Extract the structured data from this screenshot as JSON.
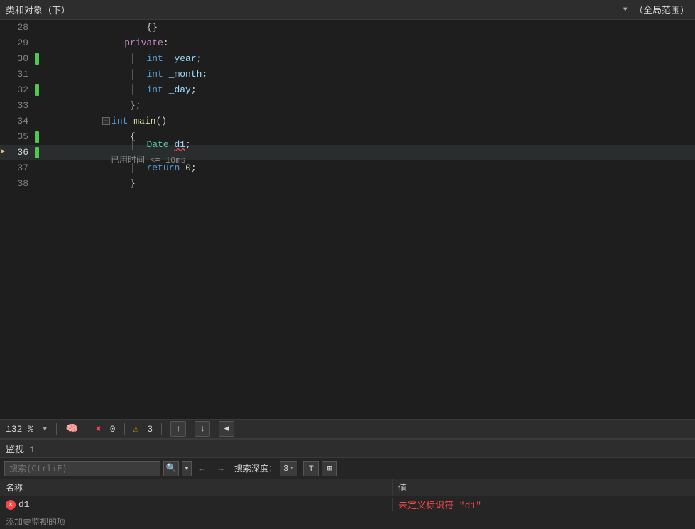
{
  "topbar": {
    "title": "类和对象（下）",
    "dropdown_arrow": "▾",
    "scope": "（全局范围）"
  },
  "editor": {
    "lines": [
      {
        "num": 28,
        "indent": 3,
        "content": "{ }",
        "tokens": [
          {
            "text": "        {}",
            "class": "punct"
          }
        ],
        "indicator": null,
        "current": false
      },
      {
        "num": 29,
        "indent": 2,
        "content": "private:",
        "tokens": [
          {
            "text": "    ",
            "class": ""
          },
          {
            "text": "private",
            "class": "kw2"
          },
          {
            "text": ":",
            "class": "punct"
          }
        ],
        "indicator": null,
        "current": false
      },
      {
        "num": 30,
        "indent": 3,
        "content": "int _year;",
        "tokens": [
          {
            "text": "        ",
            "class": ""
          },
          {
            "text": "int",
            "class": "kw"
          },
          {
            "text": " _year",
            "class": "var"
          },
          {
            "text": ";",
            "class": "punct"
          }
        ],
        "indicator": "green",
        "current": false
      },
      {
        "num": 31,
        "indent": 3,
        "content": "int _month;",
        "tokens": [
          {
            "text": "        ",
            "class": ""
          },
          {
            "text": "int",
            "class": "kw"
          },
          {
            "text": " _month",
            "class": "var"
          },
          {
            "text": ";",
            "class": "punct"
          }
        ],
        "indicator": null,
        "current": false
      },
      {
        "num": 32,
        "indent": 3,
        "content": "int _day;",
        "tokens": [
          {
            "text": "        ",
            "class": ""
          },
          {
            "text": "int",
            "class": "kw"
          },
          {
            "text": " _day",
            "class": "var"
          },
          {
            "text": ";",
            "class": "punct"
          }
        ],
        "indicator": "green",
        "current": false
      },
      {
        "num": 33,
        "indent": 2,
        "content": "};",
        "tokens": [
          {
            "text": "    ",
            "class": ""
          },
          {
            "text": "}",
            "class": "punct"
          },
          {
            "text": ";",
            "class": "punct"
          }
        ],
        "indicator": null,
        "current": false
      },
      {
        "num": 34,
        "indent": 0,
        "content": "int main()",
        "tokens": [
          {
            "text": "⊟",
            "class": "collapse"
          },
          {
            "text": "int",
            "class": "kw"
          },
          {
            "text": " ",
            "class": ""
          },
          {
            "text": "main",
            "class": "fn"
          },
          {
            "text": "()",
            "class": "punct"
          }
        ],
        "indicator": null,
        "current": false
      },
      {
        "num": 35,
        "indent": 1,
        "content": "{",
        "tokens": [
          {
            "text": "    ",
            "class": ""
          },
          {
            "text": "{",
            "class": "punct"
          }
        ],
        "indicator": "green",
        "current": false
      },
      {
        "num": 36,
        "indent": 2,
        "content": "Date d1;",
        "tokens": [
          {
            "text": "        ",
            "class": ""
          },
          {
            "text": "Date",
            "class": "type"
          },
          {
            "text": " ",
            "class": ""
          },
          {
            "text": "d1",
            "class": "squiggly var"
          },
          {
            "text": ";",
            "class": "punct"
          }
        ],
        "indicator": "green",
        "current": true,
        "annotation": "已用时间 <= 10ms"
      },
      {
        "num": 37,
        "indent": 2,
        "content": "return 0;",
        "tokens": [
          {
            "text": "        ",
            "class": ""
          },
          {
            "text": "return",
            "class": "kw"
          },
          {
            "text": " ",
            "class": ""
          },
          {
            "text": "0",
            "class": "num"
          },
          {
            "text": ";",
            "class": "punct"
          }
        ],
        "indicator": null,
        "current": false
      },
      {
        "num": 38,
        "indent": 1,
        "content": "}",
        "tokens": [
          {
            "text": "    ",
            "class": ""
          },
          {
            "text": "}",
            "class": "punct"
          }
        ],
        "indicator": null,
        "current": false
      }
    ]
  },
  "statusbar": {
    "zoom": "132 %",
    "dropdown_arrow": "▾",
    "brain_icon": "🧠",
    "errors": {
      "icon": "✖",
      "count": "0"
    },
    "warnings": {
      "icon": "⚠",
      "count": "3"
    },
    "up_arrow": "↑",
    "down_arrow": "↓",
    "left_arrow": "◄"
  },
  "watchpanel": {
    "title": "监视 1",
    "search_placeholder": "搜索(Ctrl+E)",
    "search_icon": "🔍",
    "search_dropdown": "▾",
    "nav_back": "←",
    "nav_forward": "→",
    "depth_label": "搜索深度：",
    "depth_value": "3",
    "icon1": "⊤",
    "icon2": "⊞",
    "col_name": "名称",
    "col_value": "值",
    "rows": [
      {
        "name": "d1",
        "has_error": true,
        "value": "未定义标识符 \"d1\""
      }
    ],
    "add_label": "添加要监视的项"
  }
}
